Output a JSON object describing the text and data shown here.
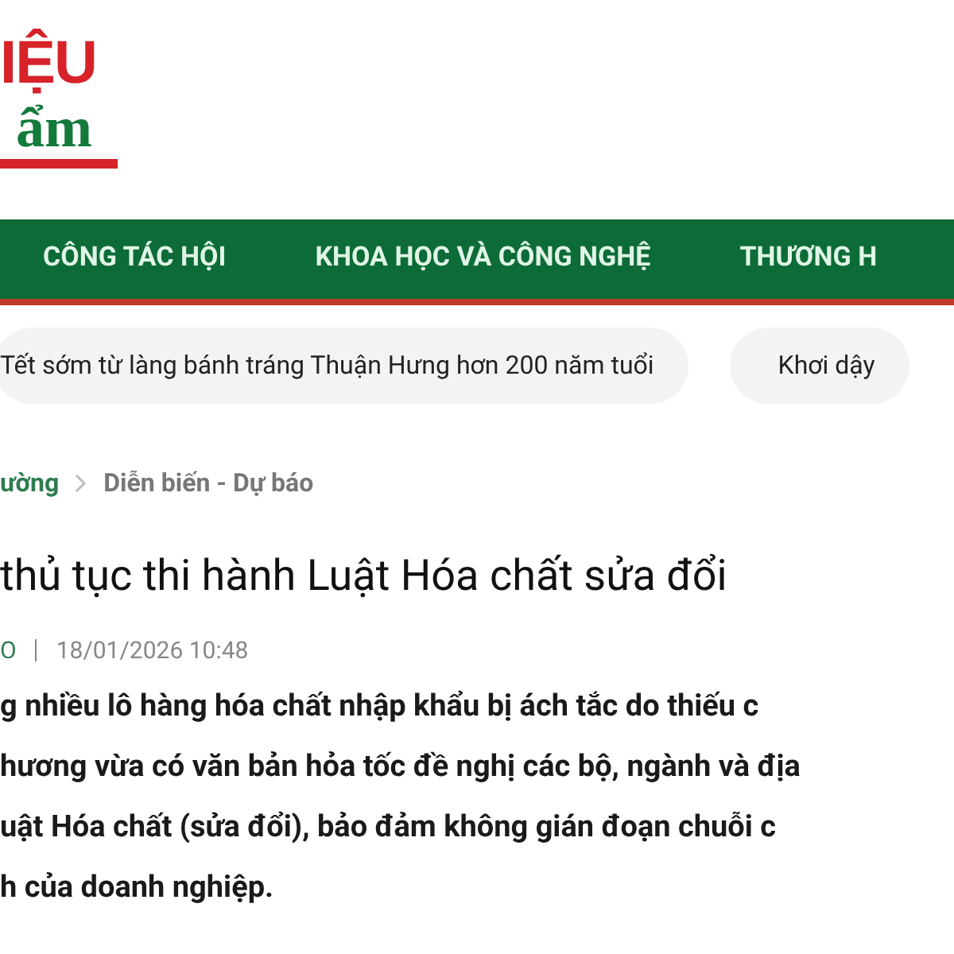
{
  "logo": {
    "line_1": "IỆU",
    "line_2": "ẩm"
  },
  "nav": {
    "items": [
      {
        "label": "CÔNG TÁC HỘI"
      },
      {
        "label": "KHOA HỌC VÀ CÔNG NGHỆ"
      },
      {
        "label": "THƯƠNG H"
      }
    ]
  },
  "trending": [
    {
      "label": "Tết sớm từ làng bánh tráng Thuận Hưng hơn 200 năm tuổi"
    },
    {
      "label": "Khơi dậy"
    }
  ],
  "breadcrumb": [
    {
      "label": "ường",
      "selected": false
    },
    {
      "label": "Diễn biến - Dự báo",
      "selected": true
    }
  ],
  "article": {
    "title": "thủ tục thi hành Luật Hóa chất sửa đổi",
    "author": "O",
    "date": "18/01/2026 10:48",
    "lead_lines": [
      "g nhiều lô hàng hóa chất nhập khẩu bị ách tắc do thiếu c",
      "hương vừa có văn bản hỏa tốc đề nghị các bộ, ngành và địa",
      "uật Hóa chất (sửa đổi), bảo đảm không gián đoạn chuỗi c",
      "h của doanh nghiệp."
    ]
  }
}
